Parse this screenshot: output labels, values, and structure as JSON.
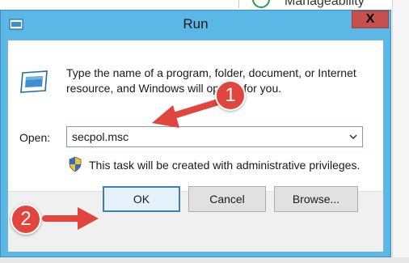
{
  "background": {
    "partial_text": "Manageability"
  },
  "dialog": {
    "title": "Run",
    "close_glyph": "X",
    "description": "Type the name of a program, folder, document, or Internet resource, and Windows will open it for you.",
    "open_label": "Open:",
    "open_value": "secpol.msc",
    "admin_note": "This task will be created with administrative privileges.",
    "buttons": {
      "ok": "OK",
      "cancel": "Cancel",
      "browse": "Browse..."
    }
  },
  "annotations": {
    "step1": "1",
    "step2": "2",
    "color": "#e0463d"
  },
  "icons": {
    "title": "run-icon",
    "large": "run-icon",
    "shield": "uac-shield-icon",
    "dropdown": "chevron-down-icon",
    "close": "close-icon"
  }
}
